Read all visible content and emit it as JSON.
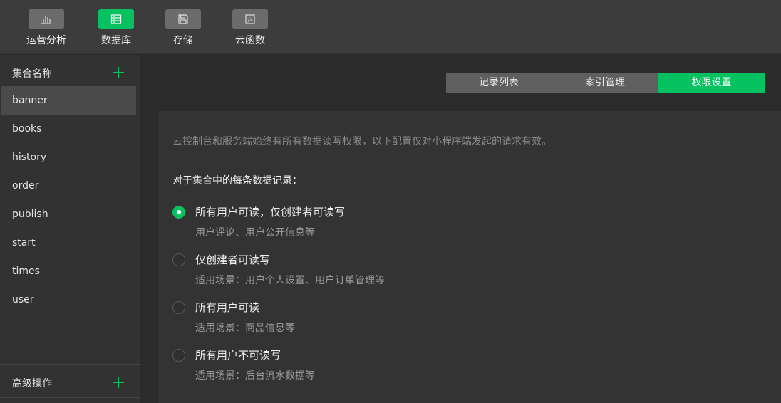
{
  "toolbar": {
    "items": [
      {
        "label": "运营分析",
        "icon": "bar-chart-icon",
        "active": false
      },
      {
        "label": "数据库",
        "icon": "database-icon",
        "active": true
      },
      {
        "label": "存储",
        "icon": "floppy-disk-icon",
        "active": false
      },
      {
        "label": "云函数",
        "icon": "function-icon",
        "active": false
      }
    ]
  },
  "sidebar": {
    "header": "集合名称",
    "collections": [
      "banner",
      "books",
      "history",
      "order",
      "publish",
      "start",
      "times",
      "user"
    ],
    "selected": "banner",
    "footer": "高级操作"
  },
  "tabs": [
    {
      "label": "记录列表",
      "active": false
    },
    {
      "label": "索引管理",
      "active": false
    },
    {
      "label": "权限设置",
      "active": true
    }
  ],
  "permissions": {
    "description": "云控制台和服务端始终有所有数据读写权限，以下配置仅对小程序端发起的请求有效。",
    "section_title": "对于集合中的每条数据记录：",
    "options": [
      {
        "label": "所有用户可读，仅创建者可读写",
        "sub": "用户评论、用户公开信息等",
        "checked": true
      },
      {
        "label": "仅创建者可读写",
        "sub": "适用场景：用户个人设置、用户订单管理等",
        "checked": false
      },
      {
        "label": "所有用户可读",
        "sub": "适用场景：商品信息等",
        "checked": false
      },
      {
        "label": "所有用户不可读写",
        "sub": "适用场景：后台流水数据等",
        "checked": false
      }
    ]
  },
  "colors": {
    "accent": "#07c160",
    "background": "#2b2b2b",
    "panel": "#333333"
  }
}
